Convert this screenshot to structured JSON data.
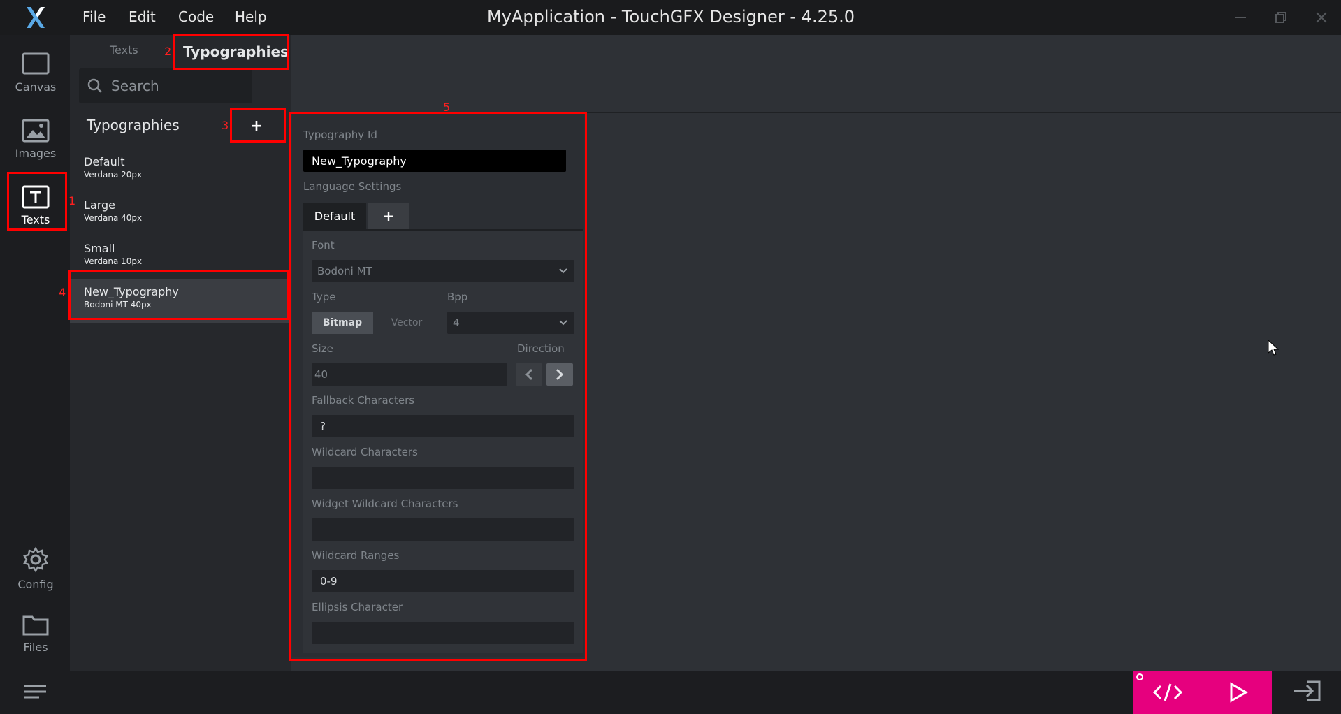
{
  "titlebar": {
    "menu": [
      "File",
      "Edit",
      "Code",
      "Help"
    ],
    "title": "MyApplication - TouchGFX Designer - 4.25.0",
    "logo_icon": "touchgfx-x-logo",
    "window_controls": [
      "minimize-icon",
      "restore-icon",
      "close-icon"
    ]
  },
  "rail": {
    "items": [
      {
        "label": "Canvas",
        "icon": "canvas-icon"
      },
      {
        "label": "Images",
        "icon": "image-icon"
      },
      {
        "label": "Texts",
        "icon": "text-icon",
        "active": true
      },
      {
        "label": "Config",
        "icon": "gear-icon"
      },
      {
        "label": "Files",
        "icon": "folder-icon"
      }
    ],
    "menu_icon": "hamburger-icon"
  },
  "subtabs": {
    "texts": "Texts",
    "typographies": "Typographies"
  },
  "search": {
    "placeholder": "Search",
    "icon": "search-icon"
  },
  "typographies": {
    "heading": "Typographies",
    "add_label": "+",
    "items": [
      {
        "name": "Default",
        "spec": "Verdana  20px"
      },
      {
        "name": "Large",
        "spec": "Verdana  40px"
      },
      {
        "name": "Small",
        "spec": "Verdana  10px"
      },
      {
        "name": "New_Typography",
        "spec": "Bodoni MT  40px",
        "selected": true
      }
    ]
  },
  "panel": {
    "typography_id_label": "Typography Id",
    "typography_id_value": "New_Typography",
    "language_settings_label": "Language Settings",
    "lang_tabs": [
      "Default",
      "+"
    ],
    "font_label": "Font",
    "font_value": "Bodoni MT",
    "type_label": "Type",
    "type_options": [
      "Bitmap",
      "Vector"
    ],
    "type_selected": "Bitmap",
    "bpp_label": "Bpp",
    "bpp_value": "4",
    "size_label": "Size",
    "size_value": "40",
    "direction_label": "Direction",
    "direction_selected": "right",
    "fallback_label": "Fallback Characters",
    "fallback_value": "?",
    "wildcard_label": "Wildcard Characters",
    "wildcard_value": "",
    "widget_wildcard_label": "Widget Wildcard Characters",
    "widget_wildcard_value": "",
    "wildcard_ranges_label": "Wildcard Ranges",
    "wildcard_ranges_value": "0-9",
    "ellipsis_label": "Ellipsis Character",
    "ellipsis_value": ""
  },
  "annotations": [
    "1",
    "2",
    "3",
    "4",
    "5"
  ],
  "colors": {
    "accent": "#e6007e",
    "highlight": "#ff0000",
    "background": "#2e3136"
  },
  "bottom": {
    "code_icon": "code-icon",
    "run_icon": "play-icon",
    "export_icon": "export-icon"
  }
}
